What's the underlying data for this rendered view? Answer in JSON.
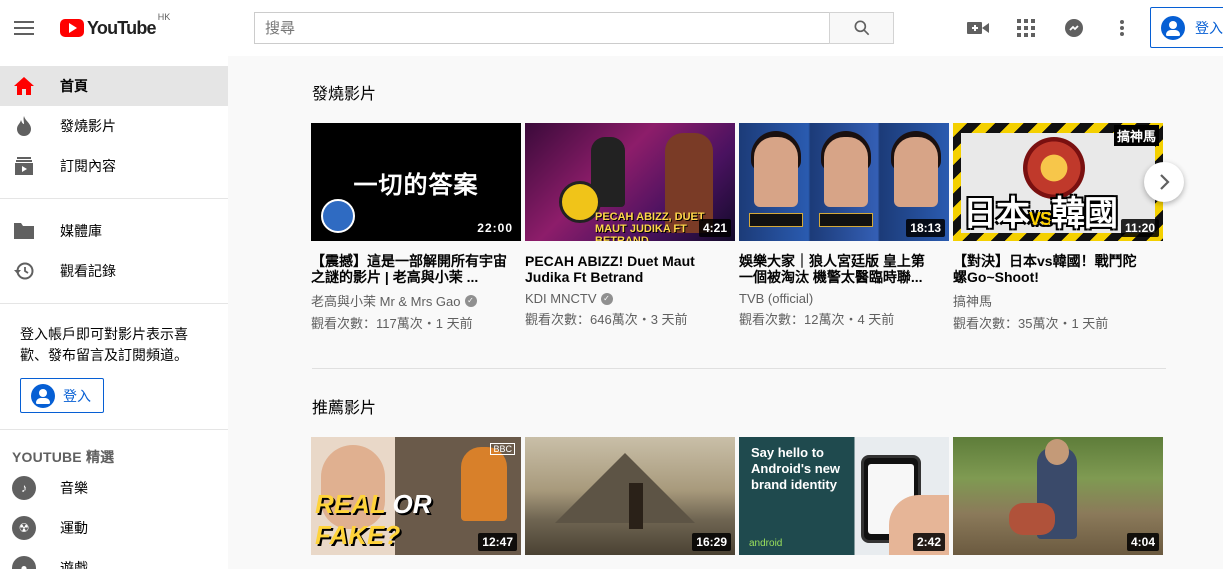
{
  "header": {
    "logo_text": "YouTube",
    "region": "HK",
    "search_placeholder": "搜尋",
    "signin_label": "登入"
  },
  "sidebar": {
    "items_main": [
      {
        "label": "首頁",
        "icon": "home-icon",
        "active": true
      },
      {
        "label": "發燒影片",
        "icon": "fire-icon"
      },
      {
        "label": "訂閱內容",
        "icon": "subscriptions-icon"
      }
    ],
    "items_library": [
      {
        "label": "媒體庫",
        "icon": "folder-icon"
      },
      {
        "label": "觀看記錄",
        "icon": "history-icon"
      }
    ],
    "signin_prompt": "登入帳戶即可對影片表示喜歡、發布留言及訂閱頻道。",
    "signin_label": "登入",
    "best_of_title": "YOUTUBE 精選",
    "best_of_items": [
      {
        "label": "音樂",
        "icon": "music-icon"
      },
      {
        "label": "運動",
        "icon": "sports-icon"
      },
      {
        "label": "遊戲",
        "icon": "gaming-icon"
      }
    ]
  },
  "main": {
    "trending": {
      "title": "發燒影片",
      "videos": [
        {
          "title": "【震撼】這是一部解開所有宇宙之謎的影片 | 老高與小茉 ...",
          "channel": "老高與小茉 Mr & Mrs Gao",
          "verified": true,
          "meta": "觀看次數：117萬次・1 天前",
          "duration": "22:00",
          "thumb_text": "一切的答案"
        },
        {
          "title": "PECAH ABIZZ! Duet Maut Judika Ft Betrand [JIKALAU...",
          "channel": "KDI MNCTV",
          "verified": true,
          "meta": "觀看次數：646萬次・3 天前",
          "duration": "4:21",
          "thumb_text": "PECAH ABIZZ, DUET MAUT JUDIKA FT BETRAND"
        },
        {
          "title": "娛樂大家｜狼人宮廷版 皇上第一個被淘汰 機警太醫臨時聯...",
          "channel": "TVB (official)",
          "verified": false,
          "meta": "觀看次數：12萬次・4 天前",
          "duration": "18:13",
          "thumb_text": ""
        },
        {
          "title": "【對決】日本vs韓國！戰鬥陀螺Go~Shoot!",
          "channel": "搞神馬",
          "verified": false,
          "meta": "觀看次數：35萬次・1 天前",
          "duration": "11:20",
          "thumb_text": "日本",
          "thumb_text_2": "VS",
          "thumb_text_3": "韓國",
          "thumb_tag": "搞神馬"
        }
      ]
    },
    "recommended": {
      "title": "推薦影片",
      "videos": [
        {
          "duration": "12:47",
          "thumb_text": "REAL",
          "thumb_text_2": "OR",
          "thumb_text_3": "FAKE?",
          "thumb_tag": "BBC"
        },
        {
          "duration": "16:29"
        },
        {
          "duration": "2:42",
          "thumb_text": "Say hello to Android's new brand identity",
          "thumb_tag": "android"
        },
        {
          "duration": "4:04"
        }
      ]
    }
  },
  "colors": {
    "brand_red": "#ff0000",
    "link_blue": "#065fd4",
    "page_bg": "#f9f9f9"
  }
}
